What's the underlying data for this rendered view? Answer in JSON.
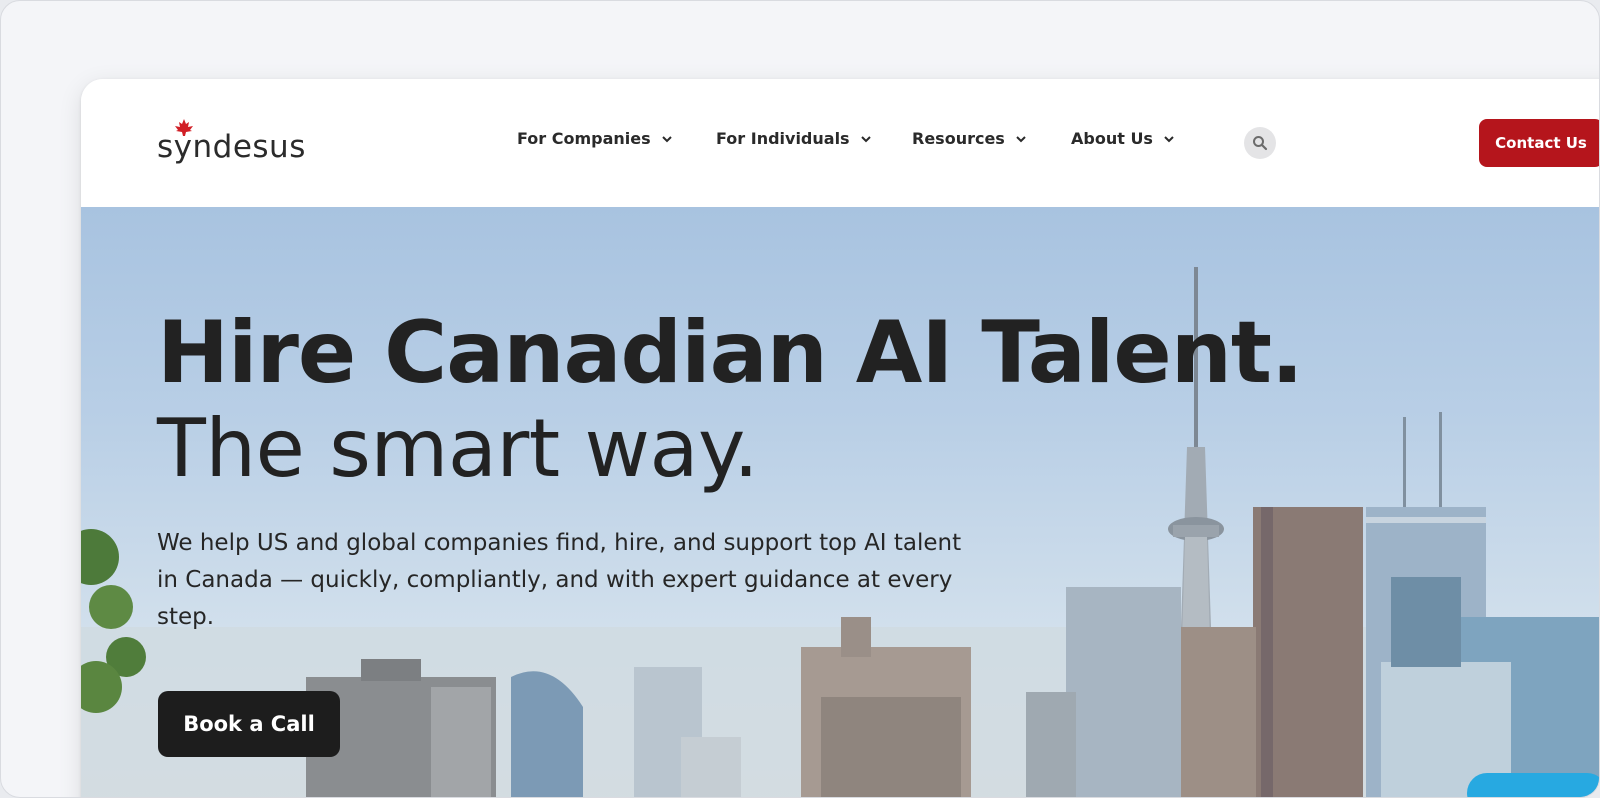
{
  "header": {
    "logo_text": "syndesus",
    "nav": [
      {
        "label": "For Companies"
      },
      {
        "label": "For Individuals"
      },
      {
        "label": "Resources"
      },
      {
        "label": "About Us"
      }
    ],
    "search_icon": "search-icon",
    "contact_label": "Contact Us"
  },
  "hero": {
    "title": "Hire Canadian AI Talent.",
    "subtitle": "The smart way.",
    "description": "We help US and global companies find, hire, and support top AI talent in Canada — quickly, compliantly, and with expert guidance at every step.",
    "cta_label": "Book a Call"
  },
  "colors": {
    "brand_red": "#b5151c",
    "cta_dark": "#1d1d1d",
    "text_dark": "#222222"
  }
}
